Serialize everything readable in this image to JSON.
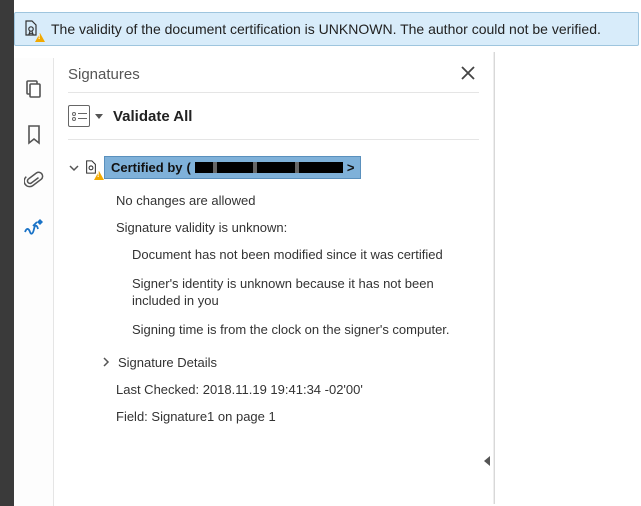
{
  "banner": {
    "message": "The validity of the document certification is UNKNOWN. The author could not be verified."
  },
  "panel": {
    "title": "Signatures",
    "validate_label": "Validate All"
  },
  "signature": {
    "certified_prefix": "Certified by ",
    "certified_open": "(",
    "certified_close": " >",
    "no_changes": "No changes are allowed",
    "validity_unknown": "Signature validity is unknown:",
    "not_modified": "Document has not been modified since it was certified",
    "identity_unknown": "Signer's identity is unknown because it has not been included in you",
    "signing_time": "Signing time is from the clock on the signer's computer.",
    "details_label": "Signature Details",
    "last_checked": "Last Checked: 2018.11.19 19:41:34 -02'00'",
    "field": "Field: Signature1 on page 1"
  }
}
